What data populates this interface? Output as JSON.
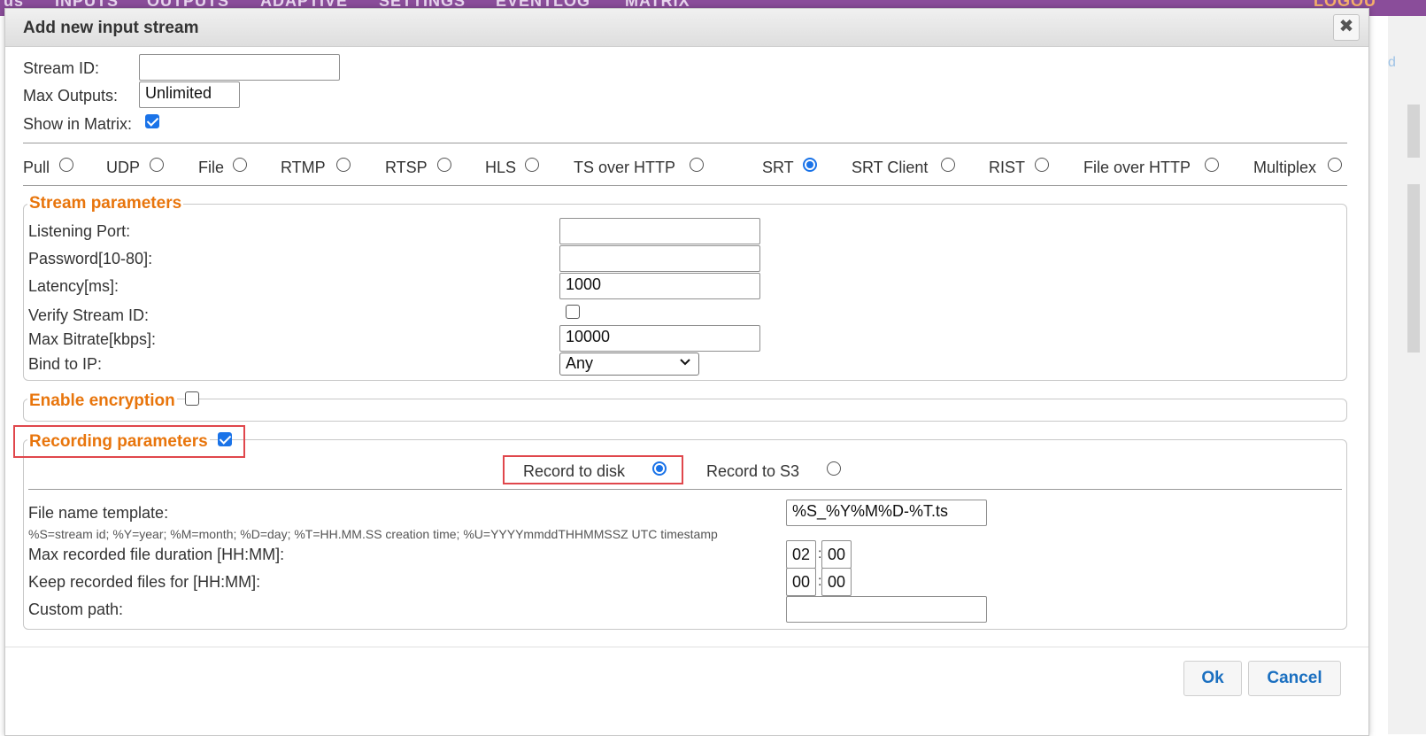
{
  "background": {
    "nav_items": [
      "us",
      "INPUTS",
      "OUTPUTS",
      "ADAPTIVE",
      "SETTINGS",
      "EVENTLOG",
      "MATRIX"
    ],
    "right_text": "LOGOU",
    "side_link": "d"
  },
  "dialog": {
    "title": "Add new input stream",
    "close_symbol": "✖",
    "stream_id_label": "Stream ID:",
    "stream_id_value": "",
    "max_outputs_label": "Max Outputs:",
    "max_outputs_value": "Unlimited",
    "show_in_matrix_label": "Show in Matrix:",
    "show_in_matrix_checked": true,
    "stream_types": [
      {
        "label": "Pull",
        "selected": false
      },
      {
        "label": "UDP",
        "selected": false
      },
      {
        "label": "File",
        "selected": false
      },
      {
        "label": "RTMP",
        "selected": false
      },
      {
        "label": "RTSP",
        "selected": false
      },
      {
        "label": "HLS",
        "selected": false
      },
      {
        "label": "TS over HTTP",
        "selected": false
      },
      {
        "label": "SRT",
        "selected": true
      },
      {
        "label": "SRT Client",
        "selected": false
      },
      {
        "label": "RIST",
        "selected": false
      },
      {
        "label": "File over HTTP",
        "selected": false
      },
      {
        "label": "Multiplex",
        "selected": false
      }
    ],
    "stream_params": {
      "legend": "Stream parameters",
      "listening_port_label": "Listening Port:",
      "listening_port_value": "",
      "password_label": "Password[10-80]:",
      "password_value": "",
      "latency_label": "Latency[ms]:",
      "latency_value": "1000",
      "verify_stream_id_label": "Verify Stream ID:",
      "verify_stream_id_checked": false,
      "max_bitrate_label": "Max Bitrate[kbps]:",
      "max_bitrate_value": "10000",
      "bind_to_ip_label": "Bind to IP:",
      "bind_to_ip_value": "Any"
    },
    "encryption": {
      "legend": "Enable encryption",
      "checked": false
    },
    "recording": {
      "legend": "Recording parameters",
      "checked": true,
      "record_to_disk_label": "Record to disk",
      "record_to_disk_selected": true,
      "record_to_s3_label": "Record to S3",
      "record_to_s3_selected": false,
      "file_name_template_label": "File name template:",
      "file_name_template_value": "%S_%Y%M%D-%T.ts",
      "template_hint": "%S=stream id; %Y=year; %M=month; %D=day; %T=HH.MM.SS creation time; %U=YYYYmmddTHHMMSSZ UTC timestamp",
      "max_duration_label": "Max recorded file duration [HH:MM]:",
      "max_duration_hh": "02",
      "max_duration_mm": "00",
      "keep_files_label": "Keep recorded files for [HH:MM]:",
      "keep_files_hh": "00",
      "keep_files_mm": "00",
      "custom_path_label": "Custom path:",
      "custom_path_value": "",
      "colon": ":"
    },
    "ok_label": "Ok",
    "cancel_label": "Cancel"
  },
  "colors": {
    "accent": "#1a73e8",
    "legend_orange": "#e8750c",
    "highlight_red": "#e0474c",
    "button_text": "#1a6fc0"
  }
}
